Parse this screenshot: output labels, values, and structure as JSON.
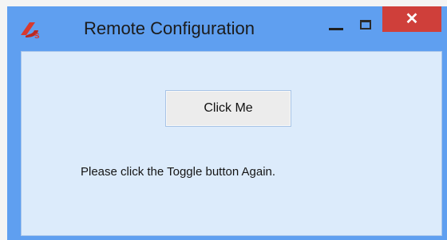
{
  "window": {
    "title": "Remote Configuration",
    "controls": {
      "minimize_icon": "minimize-icon",
      "maximize_icon": "maximize-icon",
      "close_glyph": "✕"
    },
    "app_icon": "app-logo-icon"
  },
  "main": {
    "button_label": "Click Me",
    "message": "Please click the Toggle button Again."
  },
  "colors": {
    "frame": "#5f9ff0",
    "client_bg": "#dcebfb",
    "close_button": "#cf3f3a",
    "app_icon": "#d8392f"
  }
}
